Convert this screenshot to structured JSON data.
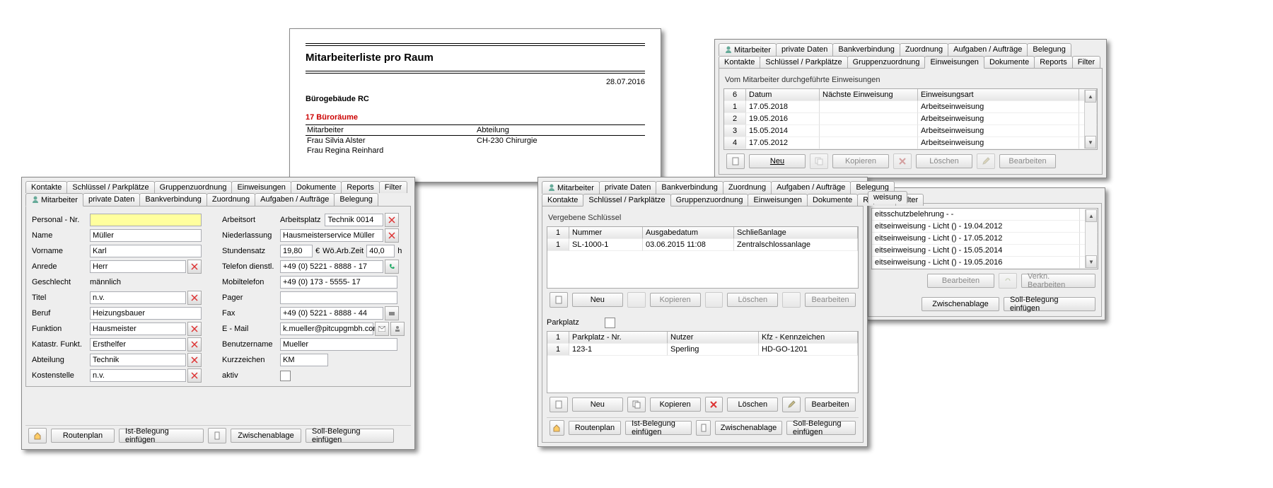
{
  "tabs": {
    "row1": [
      "Kontakte",
      "Schlüssel / Parkplätze",
      "Gruppenzuordnung",
      "Einweisungen",
      "Dokumente",
      "Reports",
      "Filter"
    ],
    "row2": [
      "Mitarbeiter",
      "private Daten",
      "Bankverbindung",
      "Zuordnung",
      "Aufgaben / Aufträge",
      "Belegung"
    ]
  },
  "report": {
    "title": "Mitarbeiterliste pro Raum",
    "date": "28.07.2016",
    "building": "Bürogebäude RC",
    "rooms_hdr": "17 Büroräume",
    "cols": [
      "Mitarbeiter",
      "Abteilung"
    ],
    "rows": [
      [
        "Frau Silvia Alster",
        "CH-230 Chirurgie"
      ],
      [
        "Frau Regina Reinhard",
        ""
      ]
    ]
  },
  "emp": {
    "left": {
      "personal_nr": {
        "lbl": "Personal - Nr.",
        "val": ""
      },
      "name": {
        "lbl": "Name",
        "val": "Müller"
      },
      "vorname": {
        "lbl": "Vorname",
        "val": "Karl"
      },
      "anrede": {
        "lbl": "Anrede",
        "val": "Herr"
      },
      "geschlecht": {
        "lbl": "Geschlecht",
        "val": "männlich"
      },
      "titel": {
        "lbl": "Titel",
        "val": "n.v."
      },
      "beruf": {
        "lbl": "Beruf",
        "val": "Heizungsbauer"
      },
      "funktion": {
        "lbl": "Funktion",
        "val": "Hausmeister"
      },
      "katastr": {
        "lbl": "Katastr. Funkt.",
        "val": "Ersthelfer"
      },
      "abteilung": {
        "lbl": "Abteilung",
        "val": "Technik"
      },
      "kostenstelle": {
        "lbl": "Kostenstelle",
        "val": "n.v."
      }
    },
    "right": {
      "arbeitsort": {
        "lbl": "Arbeitsort"
      },
      "arbeitsplatz": {
        "lbl": "Arbeitsplatz",
        "val": "Technik 0014"
      },
      "niederlassung": {
        "lbl": "Niederlassung",
        "val": "Hausmeisterservice  Müller"
      },
      "stundensatz": {
        "lbl": "Stundensatz",
        "val": "19,80",
        "unit": "€"
      },
      "woarbzeit": {
        "lbl": "Wö.Arb.Zeit",
        "val": "40,0",
        "unit": "h"
      },
      "tel_dienst": {
        "lbl": "Telefon dienstl.",
        "val": "+49 (0) 5221 - 8888 - 17"
      },
      "mobil": {
        "lbl": "Mobiltelefon",
        "val": "+49 (0) 173 - 5555- 17"
      },
      "pager": {
        "lbl": "Pager",
        "val": ""
      },
      "fax": {
        "lbl": "Fax",
        "val": "+49 (0) 5221 - 8888 - 44"
      },
      "email": {
        "lbl": "E - Mail",
        "val": "k.mueller@pitcupgmbh.com"
      },
      "benutzer": {
        "lbl": "Benutzername",
        "val": "Mueller"
      },
      "kurz": {
        "lbl": "Kurzzeichen",
        "val": "KM"
      },
      "aktiv": {
        "lbl": "aktiv"
      }
    }
  },
  "keys": {
    "hdr": "Vergebene Schlüssel",
    "cols": [
      "Nummer",
      "Ausgabedatum",
      "Schließanlage"
    ],
    "rows": [
      [
        "SL-1000-1",
        "03.06.2015 11:08",
        "Zentralschlossanlage"
      ]
    ],
    "park_lbl": "Parkplatz",
    "park_cols": [
      "Parkplatz - Nr.",
      "Nutzer",
      "Kfz - Kennzeichen"
    ],
    "park_rows": [
      [
        "123-1",
        "Sperling",
        "HD-GO-1201"
      ]
    ]
  },
  "induct": {
    "hdr": "Vom Mitarbeiter durchgeführte Einweisungen",
    "count": "6",
    "cols": [
      "Datum",
      "Nächste Einweisung",
      "Einweisungsart"
    ],
    "rows": [
      [
        "17.05.2018",
        "",
        "Arbeitseinweisung"
      ],
      [
        "19.05.2016",
        "",
        "Arbeitseinweisung"
      ],
      [
        "15.05.2014",
        "",
        "Arbeitseinweisung"
      ],
      [
        "17.05.2012",
        "",
        "Arbeitseinweisung"
      ]
    ],
    "side": [
      "eitsschutzbelehrung - -",
      "eitseinweisung - Licht () - 19.04.2012",
      "eitseinweisung - Licht () - 17.05.2012",
      "eitseinweisung - Licht () - 15.05.2014",
      "eitseinweisung - Licht () - 19.05.2016"
    ],
    "side_hdr": "weisung"
  },
  "btns": {
    "neu": "Neu",
    "kopieren": "Kopieren",
    "loeschen": "Löschen",
    "bearbeiten": "Bearbeiten",
    "routenplan": "Routenplan",
    "ist": "Ist-Belegung einfügen",
    "zwischen": "Zwischenablage",
    "soll": "Soll-Belegung einfügen",
    "verkn": "Verkn. Bearbeiten"
  },
  "num1": "1"
}
